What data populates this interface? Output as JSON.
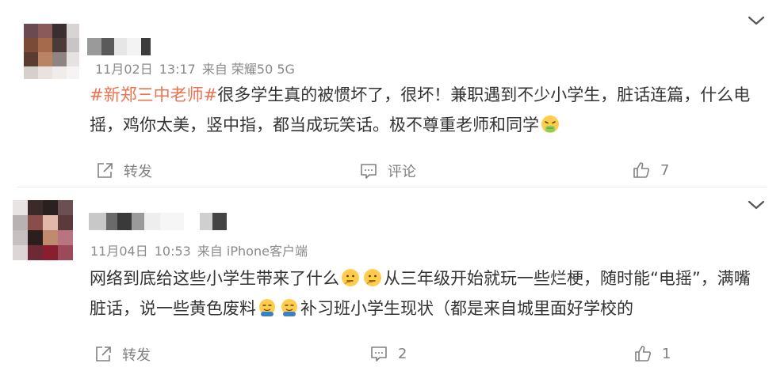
{
  "comments": [
    {
      "meta": {
        "date": "11月02日",
        "time": "13:17",
        "source": "来自 荣耀50 5G"
      },
      "text": {
        "hashtag": "#新郑三中老师#",
        "line": "很多学生真的被惯坏了，很坏！兼职遇到不少小学生，脏话连篇，什么电摇，鸡你太美，竖中指，都当成玩笑话。极不尊重老师和同学",
        "emoji": "vomit-face-emoji"
      },
      "actions": {
        "repost": "转发",
        "comment": "评论",
        "like_count": "7"
      }
    },
    {
      "meta": {
        "date": "11月04日",
        "time": "10:53",
        "source": "来自 iPhone客户端"
      },
      "text": {
        "part1": "网络到底给这些小学生带来了什么",
        "part2": "从三年级开始就玩一些烂梗，随时能“电摇”，满嘴脏话，说一些黄色废料",
        "part3": "补习班小学生现状（都是来自城里面好学校的",
        "emoji_a": "thinking-face-emoji",
        "emoji_b": "smirk-hands-emoji"
      },
      "actions": {
        "repost": "转发",
        "comment_count": "2",
        "like_count": "1"
      }
    }
  ],
  "colors": {
    "hashtag": "#eb7350",
    "meta": "#8a8a8a",
    "text": "#333333",
    "action": "#808080"
  }
}
